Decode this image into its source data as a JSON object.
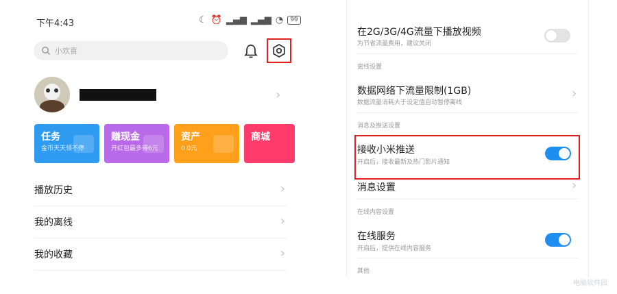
{
  "left": {
    "status_time": "下午4:43",
    "status_icons": [
      "moon-icon",
      "alarm-icon",
      "signal-icon",
      "signal-icon",
      "wifi-icon"
    ],
    "battery_level": "99",
    "search_placeholder": "小欢喜",
    "cards": [
      {
        "title": "任务",
        "subtitle": "金币天天领不停",
        "color": "#2f9bf0"
      },
      {
        "title": "赚现金",
        "subtitle": "开红包最多得6元",
        "color": "#b96ae8"
      },
      {
        "title": "资产",
        "subtitle": "0.0元",
        "color": "#ff9f1a"
      },
      {
        "title": "商城",
        "subtitle": "",
        "color": "#ff3b6b"
      }
    ],
    "menu": [
      {
        "label": "播放历史"
      },
      {
        "label": "我的离线"
      },
      {
        "label": "我的收藏"
      }
    ]
  },
  "right": {
    "items": [
      {
        "title": "在2G/3G/4G流量下播放视频",
        "subtitle": "为节省流量费用，建议关闭"
      },
      {
        "section": "离线设置"
      },
      {
        "title": "数据网络下流量限制(1GB)",
        "subtitle": "数据流量消耗大于设定值自动暂停离线"
      },
      {
        "section": "消息及推送设置"
      },
      {
        "title": "接收小米推送",
        "subtitle": "开启后，接收最新及热门影片通知"
      },
      {
        "title": "消息设置"
      },
      {
        "section": "在线内容设置"
      },
      {
        "title": "在线服务",
        "subtitle": "开启后，提供在线内容服务"
      },
      {
        "section": "其他"
      }
    ],
    "toggles": {
      "video_on_mobile": false,
      "xiaomi_push": true,
      "online_service": true
    }
  },
  "watermark": "电脑软件园",
  "colors": {
    "accent_blue": "#1e8ef0",
    "highlight_red": "#e02020"
  }
}
